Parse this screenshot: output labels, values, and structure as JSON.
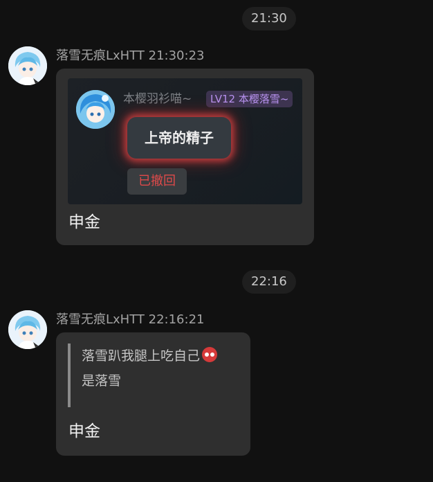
{
  "timestamps": [
    "21:30",
    "22:16"
  ],
  "messages": [
    {
      "sender": "落雪无痕LxHTT",
      "time": "21:30:23",
      "embed": {
        "name": "本樱羽衫喵~",
        "tag": "LV12 本樱落雪~",
        "bubble_text": "上帝的精子",
        "recalled_text": "已撤回"
      },
      "text": "申金"
    },
    {
      "sender": "落雪无痕LxHTT",
      "time": "22:16:21",
      "quote": [
        "落雪趴我腿上吃自己",
        "是落雪"
      ],
      "quote_emoji": "red-angry-face-emoji",
      "text": "申金"
    }
  ],
  "colors": {
    "background": "#111111",
    "bubble": "#2f2f2f",
    "recalled": "#e04a4a",
    "tag": "#b892f0"
  }
}
